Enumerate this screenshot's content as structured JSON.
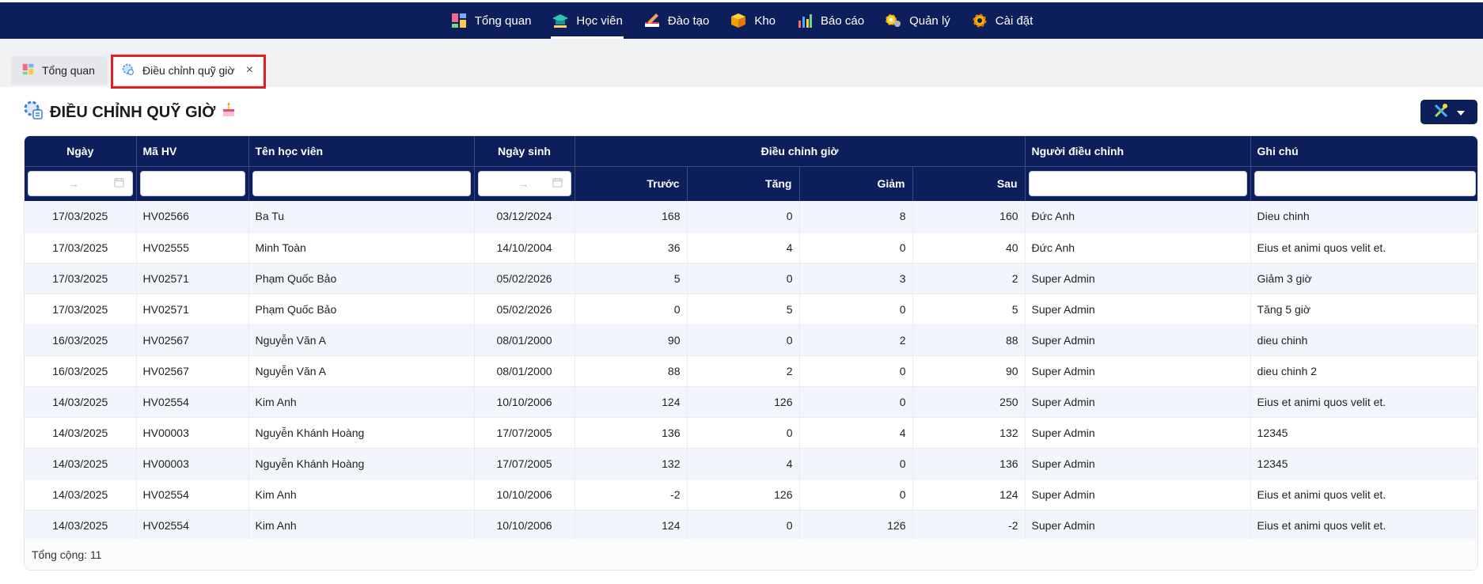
{
  "nav": {
    "items": [
      {
        "label": "Tổng quan",
        "icon": "dashboard-icon",
        "active": false
      },
      {
        "label": "Học viên",
        "icon": "graduation-cap-icon",
        "active": true
      },
      {
        "label": "Đào tạo",
        "icon": "writing-icon",
        "active": false
      },
      {
        "label": "Kho",
        "icon": "box-icon",
        "active": false
      },
      {
        "label": "Báo cáo",
        "icon": "bar-chart-icon",
        "active": false
      },
      {
        "label": "Quản lý",
        "icon": "gear-people-icon",
        "active": false
      },
      {
        "label": "Cài đặt",
        "icon": "settings-gear-icon",
        "active": false
      }
    ]
  },
  "tabs": {
    "home_label": "Tổng quan",
    "active_label": "Điều chỉnh quỹ giờ",
    "close_symbol": "×"
  },
  "page": {
    "title": "ĐIỀU CHỈNH QUỸ GIỜ"
  },
  "table": {
    "headers": {
      "date": "Ngày",
      "code": "Mã HV",
      "name": "Tên học viên",
      "dob": "Ngày sinh",
      "adjust": "Điều chỉnh giờ",
      "adjuster": "Người điều chỉnh",
      "note": "Ghi chú",
      "before": "Trước",
      "increase": "Tăng",
      "decrease": "Giảm",
      "after": "Sau"
    },
    "date_filter_arrow": "→",
    "rows": [
      {
        "date": "17/03/2025",
        "code": "HV02566",
        "name": "Ba Tu",
        "dob": "03/12/2024",
        "before": "168",
        "increase": "0",
        "decrease": "8",
        "after": "160",
        "adjuster": "Đức Anh",
        "note": "Dieu chinh"
      },
      {
        "date": "17/03/2025",
        "code": "HV02555",
        "name": "Minh Toàn",
        "dob": "14/10/2004",
        "before": "36",
        "increase": "4",
        "decrease": "0",
        "after": "40",
        "adjuster": "Đức Anh",
        "note": "Eius et animi quos velit et."
      },
      {
        "date": "17/03/2025",
        "code": "HV02571",
        "name": "Phạm Quốc Bảo",
        "dob": "05/02/2026",
        "before": "5",
        "increase": "0",
        "decrease": "3",
        "after": "2",
        "adjuster": "Super Admin",
        "note": "Giảm 3 giờ"
      },
      {
        "date": "17/03/2025",
        "code": "HV02571",
        "name": "Phạm Quốc Bảo",
        "dob": "05/02/2026",
        "before": "0",
        "increase": "5",
        "decrease": "0",
        "after": "5",
        "adjuster": "Super Admin",
        "note": "Tăng 5 giờ"
      },
      {
        "date": "16/03/2025",
        "code": "HV02567",
        "name": "Nguyễn Văn A",
        "dob": "08/01/2000",
        "before": "90",
        "increase": "0",
        "decrease": "2",
        "after": "88",
        "adjuster": "Super Admin",
        "note": "dieu chinh"
      },
      {
        "date": "16/03/2025",
        "code": "HV02567",
        "name": "Nguyễn Văn A",
        "dob": "08/01/2000",
        "before": "88",
        "increase": "2",
        "decrease": "0",
        "after": "90",
        "adjuster": "Super Admin",
        "note": "dieu chinh 2"
      },
      {
        "date": "14/03/2025",
        "code": "HV02554",
        "name": "Kim Anh",
        "dob": "10/10/2006",
        "before": "124",
        "increase": "126",
        "decrease": "0",
        "after": "250",
        "adjuster": "Super Admin",
        "note": "Eius et animi quos velit et."
      },
      {
        "date": "14/03/2025",
        "code": "HV00003",
        "name": "Nguyễn Khánh Hoàng",
        "dob": "17/07/2005",
        "before": "136",
        "increase": "0",
        "decrease": "4",
        "after": "132",
        "adjuster": "Super Admin",
        "note": "12345"
      },
      {
        "date": "14/03/2025",
        "code": "HV00003",
        "name": "Nguyễn Khánh Hoàng",
        "dob": "17/07/2005",
        "before": "132",
        "increase": "4",
        "decrease": "0",
        "after": "136",
        "adjuster": "Super Admin",
        "note": "12345"
      },
      {
        "date": "14/03/2025",
        "code": "HV02554",
        "name": "Kim Anh",
        "dob": "10/10/2006",
        "before": "-2",
        "increase": "126",
        "decrease": "0",
        "after": "124",
        "adjuster": "Super Admin",
        "note": "Eius et animi quos velit et."
      },
      {
        "date": "14/03/2025",
        "code": "HV02554",
        "name": "Kim Anh",
        "dob": "10/10/2006",
        "before": "124",
        "increase": "0",
        "decrease": "126",
        "after": "-2",
        "adjuster": "Super Admin",
        "note": "Eius et animi quos velit et."
      }
    ],
    "total_label": "Tổng cộng: 11"
  },
  "colors": {
    "navy": "#0c1f5a",
    "highlight": "#e02020"
  }
}
